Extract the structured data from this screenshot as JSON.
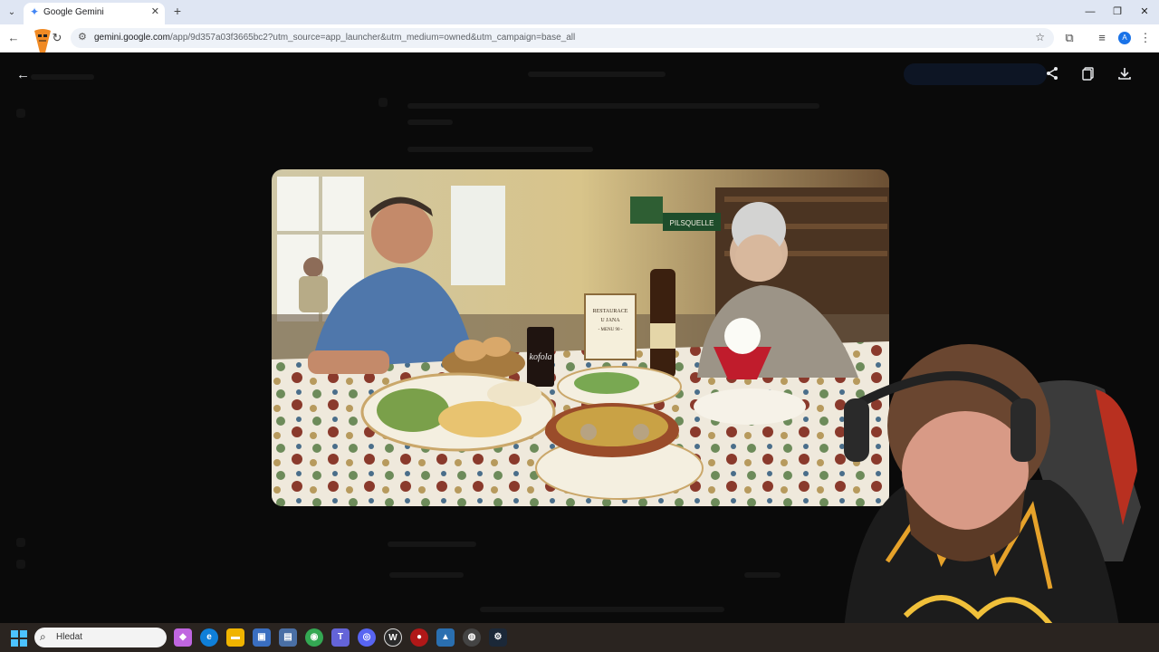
{
  "browser": {
    "tab_title": "Google Gemini",
    "new_tab_symbol": "+",
    "url_host": "gemini.google.com",
    "url_rest": "/app/9d357a03f3665bc2?utm_source=app_launcher&utm_medium=owned&utm_campaign=base_all",
    "profile_initial": "A"
  },
  "image": {
    "menu_sign_line1": "RESTAURACE",
    "menu_sign_line2": "U JANA",
    "menu_sign_line3": "- MENU 90 -",
    "brand_sign": "PILSQUELLE",
    "glass_label": "kofola"
  },
  "taskbar": {
    "search_placeholder": "Hledat"
  },
  "colors": {
    "app_background": "#0a0a0a",
    "tab_strip": "#dfe6f3",
    "taskbar": "#2a2420"
  }
}
